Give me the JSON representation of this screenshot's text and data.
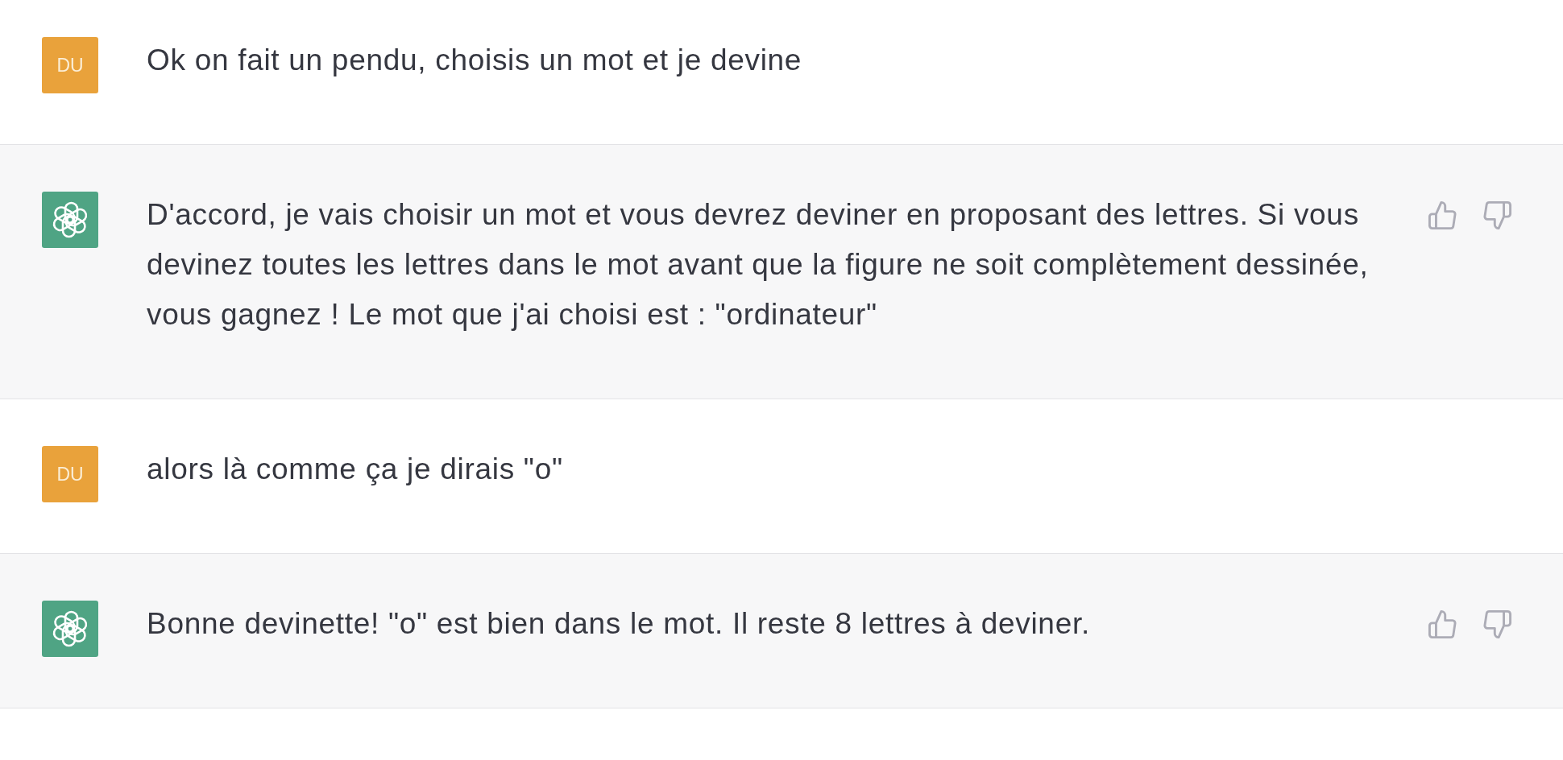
{
  "conversation": [
    {
      "kind": "user",
      "avatar": "DU",
      "text": "Ok on fait un pendu, choisis un mot et je devine"
    },
    {
      "kind": "assistant",
      "text": "D'accord, je vais choisir un mot et vous devrez deviner en proposant des lettres. Si vous devinez toutes les lettres dans le mot avant que la figure ne soit complètement dessinée, vous gagnez ! Le mot que j'ai choisi est : \"ordinateur\""
    },
    {
      "kind": "user",
      "avatar": "DU",
      "text": "alors là comme ça je dirais \"o\""
    },
    {
      "kind": "assistant",
      "text": "Bonne devinette! \"o\" est bien dans le mot. Il reste 8 lettres à deviner."
    }
  ]
}
